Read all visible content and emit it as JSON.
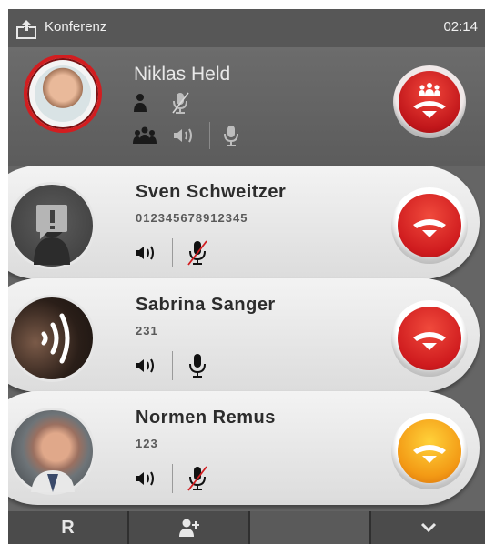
{
  "status_bar": {
    "title": "Konferenz",
    "time": "02:14"
  },
  "conference": {
    "name": "Niklas Held"
  },
  "calls": [
    {
      "name": "Sven Schweitzer",
      "number": "012345678912345",
      "muted": true,
      "hangup_color": "#cf1b1e"
    },
    {
      "name": "Sabrina Sanger",
      "number": "231",
      "muted": false,
      "hangup_color": "#cf1b1e"
    },
    {
      "name": "Normen Remus",
      "number": "123",
      "muted": true,
      "hangup_color": "#f39a15"
    }
  ],
  "bottom_bar": {
    "r_label": "R"
  },
  "icons": {
    "status": "share-icon",
    "hangup": "hang-up-icon",
    "conference_hangup": "conference-hang-up-icon",
    "speaker": "speaker-icon",
    "mic": "microphone-icon",
    "mic_muted": "microphone-muted-icon",
    "add_person": "add-person-icon",
    "chevron": "chevron-down-icon"
  },
  "colors": {
    "accent_red": "#cf1b1e",
    "accent_orange": "#f39a15",
    "background": "#656565"
  }
}
